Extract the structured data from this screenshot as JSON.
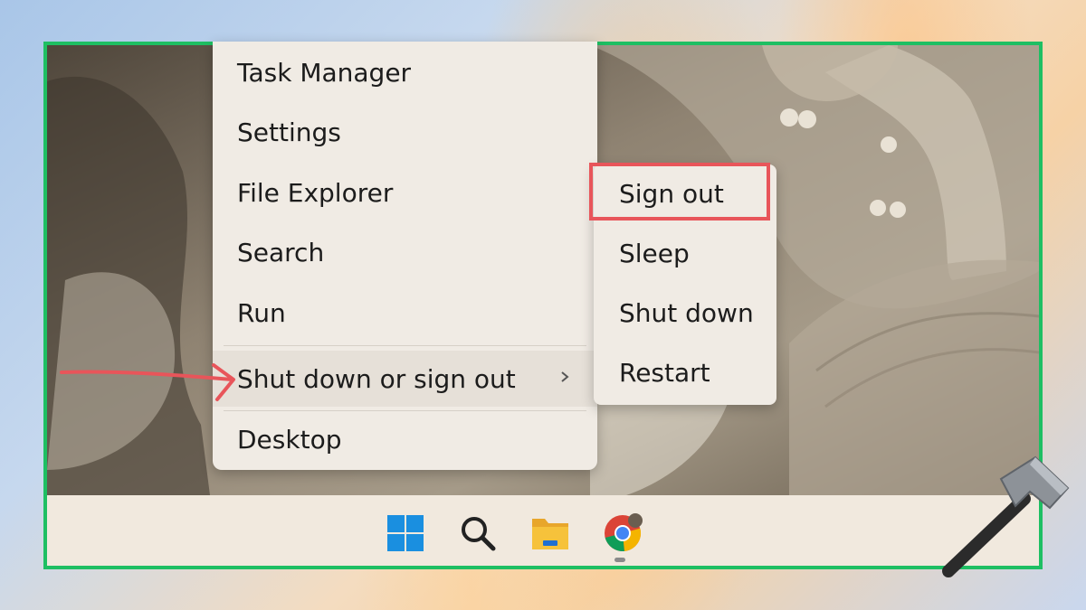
{
  "context_menu": {
    "items": [
      {
        "label": "Task Manager"
      },
      {
        "label": "Settings"
      },
      {
        "label": "File Explorer"
      },
      {
        "label": "Search"
      },
      {
        "label": "Run"
      },
      {
        "label": "Shut down or sign out",
        "has_submenu": true,
        "active": true
      },
      {
        "label": "Desktop"
      }
    ]
  },
  "submenu": {
    "items": [
      {
        "label": "Sign out",
        "highlighted": true
      },
      {
        "label": "Sleep"
      },
      {
        "label": "Shut down"
      },
      {
        "label": "Restart"
      }
    ]
  },
  "taskbar": {
    "icons": [
      "windows-start-icon",
      "search-icon",
      "file-explorer-icon",
      "chrome-icon"
    ]
  },
  "colors": {
    "frame_border": "#1ebf63",
    "highlight_box": "#e8555a",
    "arrow": "#e8555a",
    "menu_background": "#f0ebe4",
    "taskbar_background": "#f1e9de"
  }
}
